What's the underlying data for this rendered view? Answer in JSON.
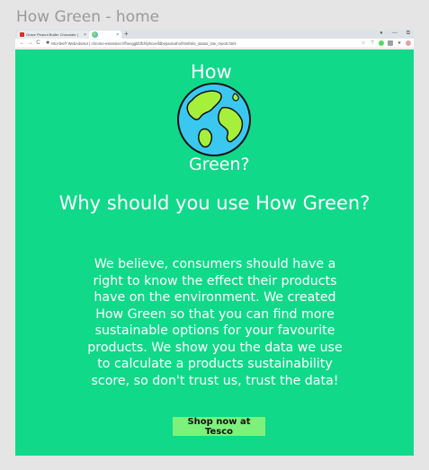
{
  "frame": {
    "title": "How Green - home"
  },
  "browser": {
    "tabs": [
      {
        "label": "Grace Peanut Butter Chocolate |",
        "close": "×"
      },
      {
        "label": "",
        "close": "×"
      }
    ],
    "new_tab": "+",
    "window_controls": [
      "●",
      "—",
      "⧉"
    ],
    "nav": {
      "back": "←",
      "forward": "→",
      "reload": "C"
    },
    "address": "McAfee® WebAdvisor | chrome-extension://fheoggkfdfchfphceeifdbepaoicaho/html/site_status_site_report.html",
    "extensions": [
      "☆",
      "⊤",
      "",
      "",
      "★",
      ""
    ]
  },
  "page": {
    "logo_top": "How",
    "logo_bottom": "Green?",
    "headline": "Why should you use How Green?",
    "body": "We believe, consumers should have a right to know the effect their products have on the environment. We created How Green so that you can find more sustainable options for your favourite products. We show you the data we use to calculate a products sustainability score, so don't trust us, trust the data!",
    "cta_label": "Shop now at Tesco"
  },
  "colors": {
    "background": "#10d98a",
    "cta": "#7df27a",
    "ocean": "#3bc8f0",
    "land": "#a6f03c"
  }
}
